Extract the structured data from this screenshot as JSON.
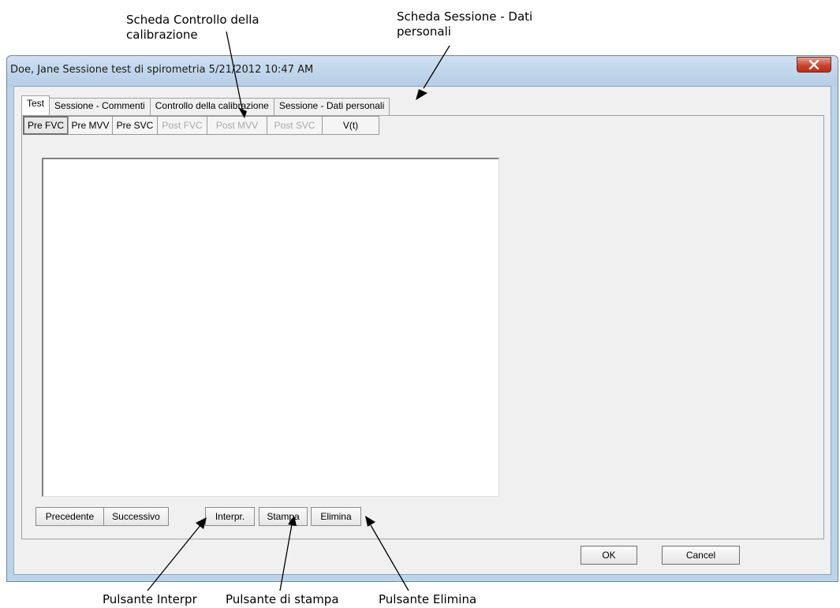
{
  "callouts": {
    "calibration_tab": "Scheda Controllo della calibrazione",
    "personal_data_tab": "Scheda Sessione - Dati personali",
    "interpr_button": "Pulsante Interpr",
    "print_button": "Pulsante di stampa",
    "delete_button": "Pulsante Elimina"
  },
  "window": {
    "title": "Doe, Jane Sessione test di spirometria 5/21/2012 10:47 AM",
    "close_icon": "close-x-icon"
  },
  "tabs": [
    {
      "label": "Test",
      "active": true
    },
    {
      "label": "Sessione - Commenti",
      "active": false
    },
    {
      "label": "Controllo della calibrazione",
      "active": false
    },
    {
      "label": "Sessione - Dati personali",
      "active": false
    }
  ],
  "subtabs": [
    {
      "label": "Pre FVC",
      "enabled": true,
      "selected": true
    },
    {
      "label": "Pre MVV",
      "enabled": true
    },
    {
      "label": "Pre SVC",
      "enabled": true
    },
    {
      "label": "Post FVC",
      "enabled": false
    },
    {
      "label": "Post MVV",
      "enabled": false
    },
    {
      "label": "Post SVC",
      "enabled": false
    },
    {
      "label": "V(t)",
      "enabled": true
    }
  ],
  "nav_buttons": {
    "previous": "Precedente",
    "next": "Successivo"
  },
  "action_buttons": {
    "interpret": "Interpr.",
    "print": "Stampa",
    "delete": "Elimina"
  },
  "dialog_buttons": {
    "ok": "OK",
    "cancel": "Cancel"
  },
  "colors": {
    "close_button": "#c8452f",
    "frame": "#bcd4ea"
  }
}
